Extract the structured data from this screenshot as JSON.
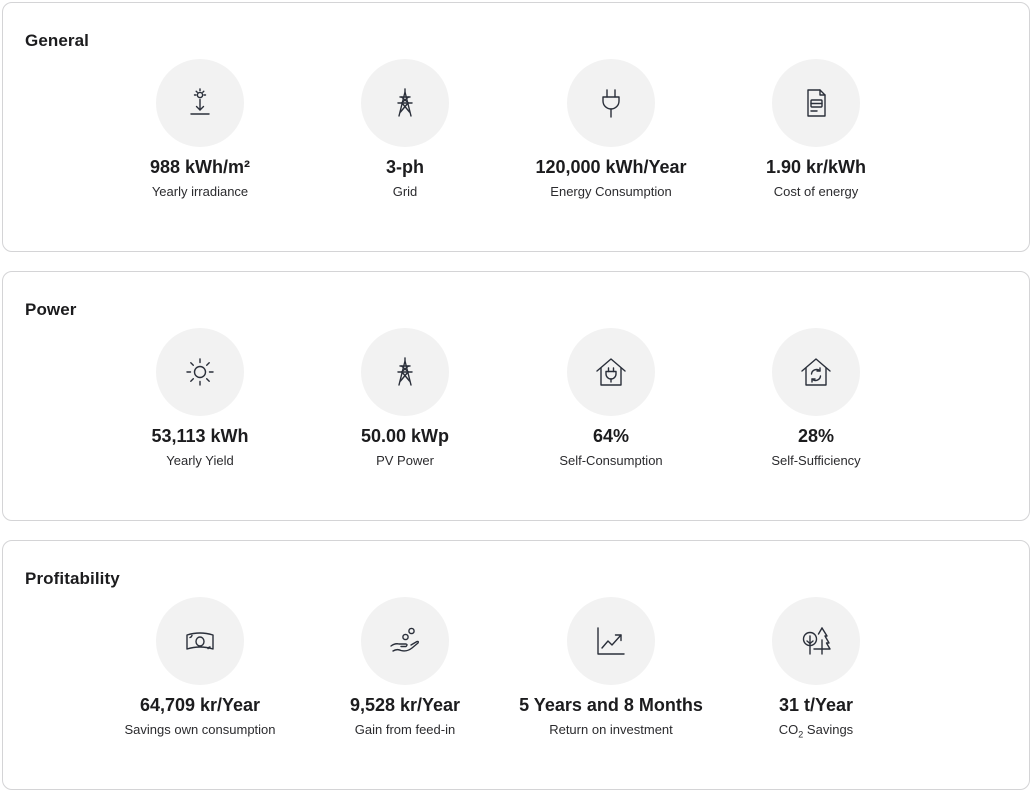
{
  "sections": [
    {
      "title": "General",
      "metrics": [
        {
          "icon": "irradiance-icon",
          "value": "988 kWh/m²",
          "label": "Yearly irradiance"
        },
        {
          "icon": "power-tower-icon",
          "value": "3-ph",
          "label": "Grid"
        },
        {
          "icon": "plug-icon",
          "value": "120,000 kWh/Year",
          "label": "Energy Consumption"
        },
        {
          "icon": "invoice-icon",
          "value": "1.90 kr/kWh",
          "label": "Cost of energy"
        }
      ]
    },
    {
      "title": "Power",
      "metrics": [
        {
          "icon": "sun-icon",
          "value": "53,113 kWh",
          "label": "Yearly Yield"
        },
        {
          "icon": "power-tower-icon",
          "value": "50.00 kWp",
          "label": "PV Power"
        },
        {
          "icon": "house-plug-icon",
          "value": "64%",
          "label": "Self-Consumption"
        },
        {
          "icon": "house-cycle-icon",
          "value": "28%",
          "label": "Self-Sufficiency"
        }
      ]
    },
    {
      "title": "Profitability",
      "metrics": [
        {
          "icon": "banknote-icon",
          "value": "64,709 kr/Year",
          "label": "Savings own consumption"
        },
        {
          "icon": "hand-coins-icon",
          "value": "9,528 kr/Year",
          "label": "Gain from feed-in"
        },
        {
          "icon": "chart-up-icon",
          "value": "5 Years and 8 Months",
          "label": "Return on investment"
        },
        {
          "icon": "trees-icon",
          "value": "31 t/Year",
          "label_main": "CO",
          "label_sub": "2",
          "label_rest": " Savings"
        }
      ]
    }
  ]
}
